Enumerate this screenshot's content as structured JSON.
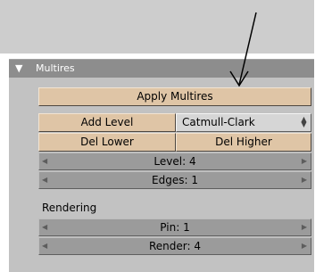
{
  "panel": {
    "title": "Multires",
    "collapse_glyph": "▼"
  },
  "buttons": {
    "apply": "Apply Multires",
    "add_level": "Add Level",
    "del_lower": "Del Lower",
    "del_higher": "Del Higher"
  },
  "subdivision_menu": {
    "selected": "Catmull-Clark"
  },
  "fields": {
    "level": "Level: 4",
    "edges": "Edges: 1",
    "pin": "Pin: 1",
    "render": "Render: 4"
  },
  "sections": {
    "rendering": "Rendering"
  },
  "icons": {
    "collapse": "triangle-down-icon",
    "arrow_left": "arrow-left-icon",
    "arrow_right": "arrow-right-icon",
    "stepper": "up-down-stepper-icon"
  },
  "colors": {
    "button": "#dfc5a6",
    "number_field": "#9b9b9b",
    "panel_body": "#c2c2c2",
    "panel_header": "#8d8d8d"
  }
}
